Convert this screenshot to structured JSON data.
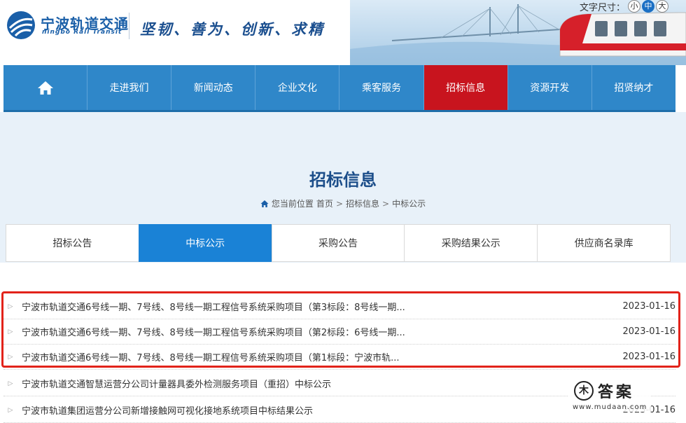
{
  "header": {
    "logo_cn": "宁波轨道交通",
    "logo_en": "ningbo Rail Transit",
    "slogan": "坚韧、善为、创新、求精",
    "font_size": {
      "label": "文字尺寸：",
      "options": [
        "小",
        "中",
        "大"
      ],
      "selected": "中"
    }
  },
  "nav": {
    "home_icon": "home-icon",
    "items": [
      "走进我们",
      "新闻动态",
      "企业文化",
      "乘客服务",
      "招标信息",
      "资源开发",
      "招贤纳才"
    ],
    "active": "招标信息"
  },
  "page": {
    "title": "招标信息",
    "breadcrumb": {
      "prefix": "您当前位置",
      "items": [
        "首页",
        "招标信息",
        "中标公示"
      ],
      "separator": ">"
    }
  },
  "tabs": {
    "items": [
      "招标公告",
      "中标公示",
      "采购公告",
      "采购结果公示",
      "供应商名录库"
    ],
    "active": "中标公示"
  },
  "list": [
    {
      "title": "宁波市轨道交通6号线一期、7号线、8号线一期工程信号系统采购项目（第3标段：8号线一期...",
      "date": "2023-01-16"
    },
    {
      "title": "宁波市轨道交通6号线一期、7号线、8号线一期工程信号系统采购项目（第2标段：6号线一期...",
      "date": "2023-01-16"
    },
    {
      "title": "宁波市轨道交通6号线一期、7号线、8号线一期工程信号系统采购项目（第1标段：宁波市轨...",
      "date": "2023-01-16"
    },
    {
      "title": "宁波市轨道交通智慧运营分公司计量器具委外检测服务项目（重招）中标公示",
      "date": ""
    },
    {
      "title": "宁波市轨道集团运营分公司新增接触网可视化接地系统项目中标结果公示",
      "date": "2023-01-16"
    }
  ],
  "watermark": {
    "text": "答案",
    "url": "www.mudaan.com"
  },
  "colors": {
    "nav_bg": "#2f87c9",
    "nav_active": "#c8141e",
    "tab_active": "#1a82d6",
    "highlight": "#e2231a",
    "title": "#1c4e8a"
  }
}
